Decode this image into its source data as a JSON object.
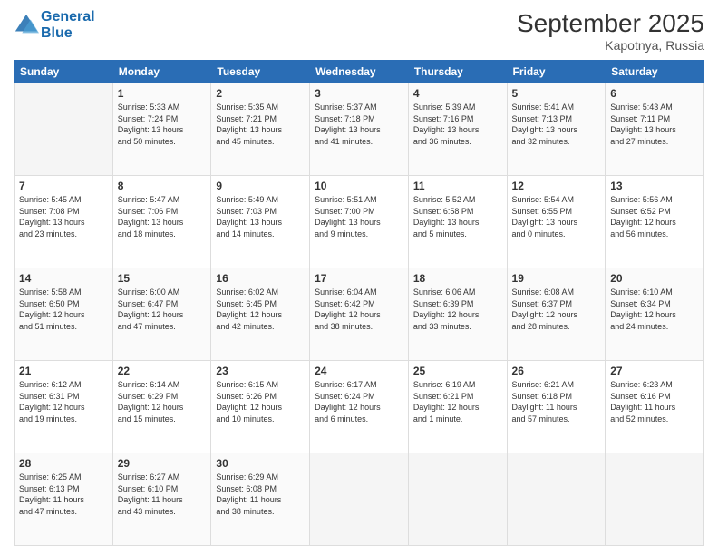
{
  "header": {
    "logo_line1": "General",
    "logo_line2": "Blue",
    "month_title": "September 2025",
    "location": "Kapotnya, Russia"
  },
  "days_of_week": [
    "Sunday",
    "Monday",
    "Tuesday",
    "Wednesday",
    "Thursday",
    "Friday",
    "Saturday"
  ],
  "weeks": [
    [
      {
        "day": "",
        "info": ""
      },
      {
        "day": "1",
        "info": "Sunrise: 5:33 AM\nSunset: 7:24 PM\nDaylight: 13 hours\nand 50 minutes."
      },
      {
        "day": "2",
        "info": "Sunrise: 5:35 AM\nSunset: 7:21 PM\nDaylight: 13 hours\nand 45 minutes."
      },
      {
        "day": "3",
        "info": "Sunrise: 5:37 AM\nSunset: 7:18 PM\nDaylight: 13 hours\nand 41 minutes."
      },
      {
        "day": "4",
        "info": "Sunrise: 5:39 AM\nSunset: 7:16 PM\nDaylight: 13 hours\nand 36 minutes."
      },
      {
        "day": "5",
        "info": "Sunrise: 5:41 AM\nSunset: 7:13 PM\nDaylight: 13 hours\nand 32 minutes."
      },
      {
        "day": "6",
        "info": "Sunrise: 5:43 AM\nSunset: 7:11 PM\nDaylight: 13 hours\nand 27 minutes."
      }
    ],
    [
      {
        "day": "7",
        "info": "Sunrise: 5:45 AM\nSunset: 7:08 PM\nDaylight: 13 hours\nand 23 minutes."
      },
      {
        "day": "8",
        "info": "Sunrise: 5:47 AM\nSunset: 7:06 PM\nDaylight: 13 hours\nand 18 minutes."
      },
      {
        "day": "9",
        "info": "Sunrise: 5:49 AM\nSunset: 7:03 PM\nDaylight: 13 hours\nand 14 minutes."
      },
      {
        "day": "10",
        "info": "Sunrise: 5:51 AM\nSunset: 7:00 PM\nDaylight: 13 hours\nand 9 minutes."
      },
      {
        "day": "11",
        "info": "Sunrise: 5:52 AM\nSunset: 6:58 PM\nDaylight: 13 hours\nand 5 minutes."
      },
      {
        "day": "12",
        "info": "Sunrise: 5:54 AM\nSunset: 6:55 PM\nDaylight: 13 hours\nand 0 minutes."
      },
      {
        "day": "13",
        "info": "Sunrise: 5:56 AM\nSunset: 6:52 PM\nDaylight: 12 hours\nand 56 minutes."
      }
    ],
    [
      {
        "day": "14",
        "info": "Sunrise: 5:58 AM\nSunset: 6:50 PM\nDaylight: 12 hours\nand 51 minutes."
      },
      {
        "day": "15",
        "info": "Sunrise: 6:00 AM\nSunset: 6:47 PM\nDaylight: 12 hours\nand 47 minutes."
      },
      {
        "day": "16",
        "info": "Sunrise: 6:02 AM\nSunset: 6:45 PM\nDaylight: 12 hours\nand 42 minutes."
      },
      {
        "day": "17",
        "info": "Sunrise: 6:04 AM\nSunset: 6:42 PM\nDaylight: 12 hours\nand 38 minutes."
      },
      {
        "day": "18",
        "info": "Sunrise: 6:06 AM\nSunset: 6:39 PM\nDaylight: 12 hours\nand 33 minutes."
      },
      {
        "day": "19",
        "info": "Sunrise: 6:08 AM\nSunset: 6:37 PM\nDaylight: 12 hours\nand 28 minutes."
      },
      {
        "day": "20",
        "info": "Sunrise: 6:10 AM\nSunset: 6:34 PM\nDaylight: 12 hours\nand 24 minutes."
      }
    ],
    [
      {
        "day": "21",
        "info": "Sunrise: 6:12 AM\nSunset: 6:31 PM\nDaylight: 12 hours\nand 19 minutes."
      },
      {
        "day": "22",
        "info": "Sunrise: 6:14 AM\nSunset: 6:29 PM\nDaylight: 12 hours\nand 15 minutes."
      },
      {
        "day": "23",
        "info": "Sunrise: 6:15 AM\nSunset: 6:26 PM\nDaylight: 12 hours\nand 10 minutes."
      },
      {
        "day": "24",
        "info": "Sunrise: 6:17 AM\nSunset: 6:24 PM\nDaylight: 12 hours\nand 6 minutes."
      },
      {
        "day": "25",
        "info": "Sunrise: 6:19 AM\nSunset: 6:21 PM\nDaylight: 12 hours\nand 1 minute."
      },
      {
        "day": "26",
        "info": "Sunrise: 6:21 AM\nSunset: 6:18 PM\nDaylight: 11 hours\nand 57 minutes."
      },
      {
        "day": "27",
        "info": "Sunrise: 6:23 AM\nSunset: 6:16 PM\nDaylight: 11 hours\nand 52 minutes."
      }
    ],
    [
      {
        "day": "28",
        "info": "Sunrise: 6:25 AM\nSunset: 6:13 PM\nDaylight: 11 hours\nand 47 minutes."
      },
      {
        "day": "29",
        "info": "Sunrise: 6:27 AM\nSunset: 6:10 PM\nDaylight: 11 hours\nand 43 minutes."
      },
      {
        "day": "30",
        "info": "Sunrise: 6:29 AM\nSunset: 6:08 PM\nDaylight: 11 hours\nand 38 minutes."
      },
      {
        "day": "",
        "info": ""
      },
      {
        "day": "",
        "info": ""
      },
      {
        "day": "",
        "info": ""
      },
      {
        "day": "",
        "info": ""
      }
    ]
  ]
}
